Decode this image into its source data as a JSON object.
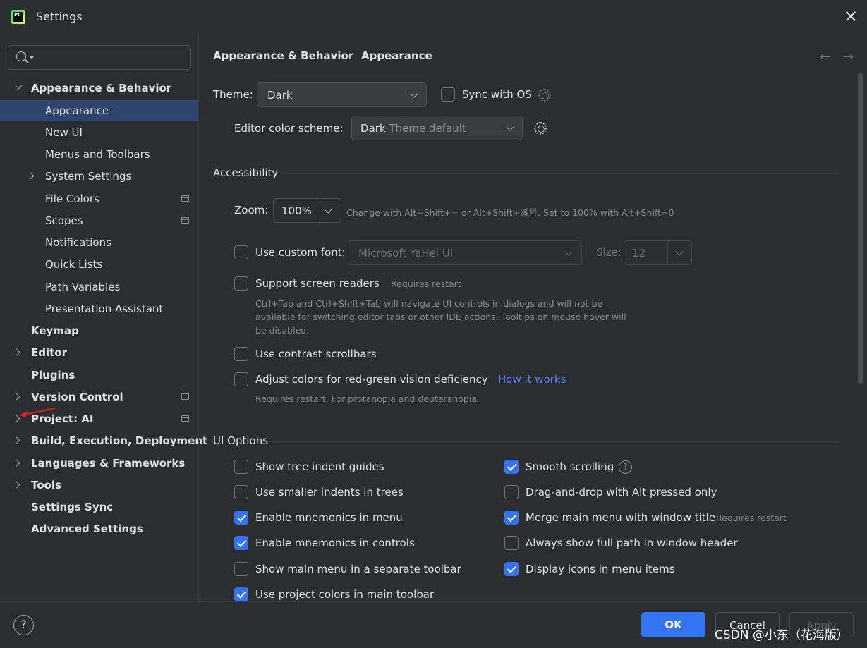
{
  "window": {
    "title": "Settings",
    "logo_text": "PC"
  },
  "sidebar": {
    "items": [
      {
        "label": "Appearance & Behavior",
        "expanded": true
      },
      {
        "label": "Appearance"
      },
      {
        "label": "New UI"
      },
      {
        "label": "Menus and Toolbars"
      },
      {
        "label": "System Settings"
      },
      {
        "label": "File Colors"
      },
      {
        "label": "Scopes"
      },
      {
        "label": "Notifications"
      },
      {
        "label": "Quick Lists"
      },
      {
        "label": "Path Variables"
      },
      {
        "label": "Presentation Assistant"
      },
      {
        "label": "Keymap"
      },
      {
        "label": "Editor"
      },
      {
        "label": "Plugins"
      },
      {
        "label": "Version Control"
      },
      {
        "label": "Project: AI"
      },
      {
        "label": "Build, Execution, Deployment"
      },
      {
        "label": "Languages & Frameworks"
      },
      {
        "label": "Tools"
      },
      {
        "label": "Settings Sync"
      },
      {
        "label": "Advanced Settings"
      }
    ]
  },
  "breadcrumb": {
    "parent": "Appearance & Behavior",
    "separator": "›",
    "current": "Appearance"
  },
  "theme": {
    "label": "Theme:",
    "value": "Dark",
    "sync_label": "Sync with OS"
  },
  "color_scheme": {
    "label": "Editor color scheme:",
    "value": "Dark",
    "value_suffix": "Theme default"
  },
  "accessibility": {
    "title": "Accessibility",
    "zoom_label": "Zoom:",
    "zoom_value": "100%",
    "zoom_hint": "Change with Alt+Shift+= or Alt+Shift+减号. Set to 100% with Alt+Shift+0",
    "custom_font_label": "Use custom font:",
    "custom_font_value": "Microsoft YaHei UI",
    "size_label": "Size:",
    "size_value": "12",
    "screen_readers_label": "Support screen readers",
    "screen_readers_hint": "Requires restart",
    "screen_readers_desc": "Ctrl+Tab and Ctrl+Shift+Tab will navigate UI controls in dialogs and will not be available for switching editor tabs or other IDE actions. Tooltips on mouse hover will be disabled.",
    "contrast_label": "Use contrast scrollbars",
    "vision_label": "Adjust colors for red-green vision deficiency",
    "vision_link": "How it works",
    "vision_hint": "Requires restart. For protanopia and deuteranopia."
  },
  "ui_options": {
    "title": "UI Options",
    "left": [
      {
        "label": "Show tree indent guides",
        "checked": false
      },
      {
        "label": "Use smaller indents in trees",
        "checked": false
      },
      {
        "label": "Enable mnemonics in menu",
        "checked": true
      },
      {
        "label": "Enable mnemonics in controls",
        "checked": true
      },
      {
        "label": "Show main menu in a separate toolbar",
        "checked": false
      },
      {
        "label": "Use project colors in main toolbar",
        "checked": true
      }
    ],
    "right": [
      {
        "label": "Smooth scrolling",
        "checked": true
      },
      {
        "label": "Drag-and-drop with Alt pressed only",
        "checked": false
      },
      {
        "label": "Merge main menu with window title",
        "checked": true,
        "hint": "Requires restart"
      },
      {
        "label": "Always show full path in window header",
        "checked": false
      },
      {
        "label": "Display icons in menu items",
        "checked": true
      }
    ]
  },
  "footer": {
    "help": "?",
    "ok": "OK",
    "cancel": "Cancel",
    "apply": "Apply"
  },
  "watermark": "CSDN @小东（花海版）",
  "colors": {
    "accent": "#3574f0",
    "selection": "#2e436e",
    "link": "#548af7",
    "background": "#2b2d30"
  }
}
